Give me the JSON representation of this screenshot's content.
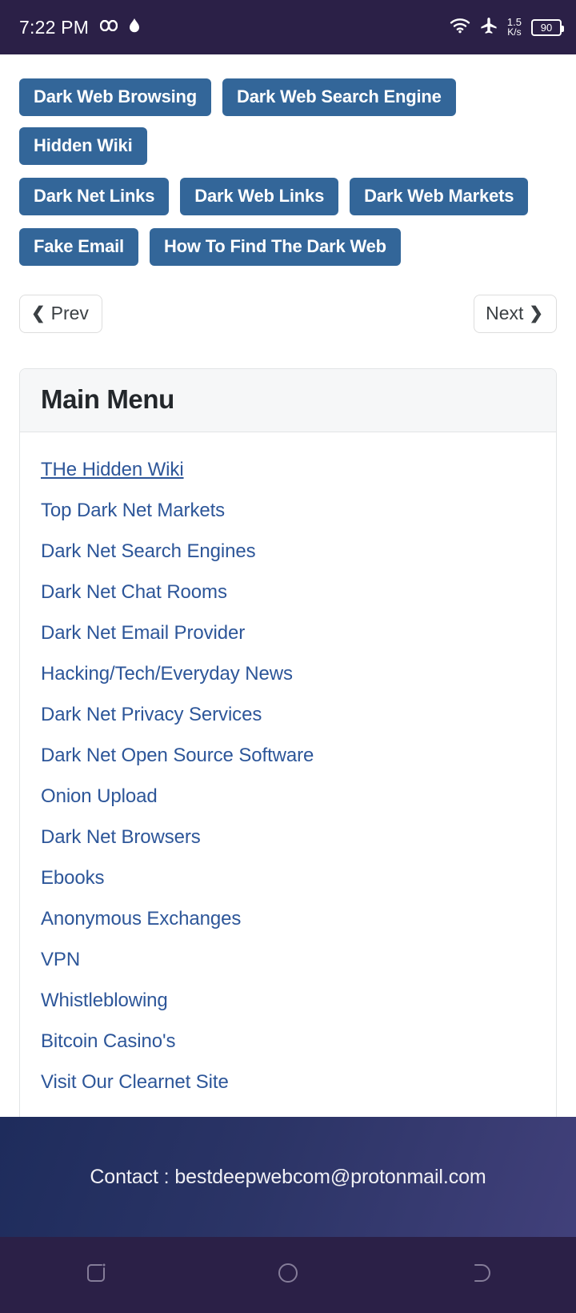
{
  "status_bar": {
    "time": "7:22 PM",
    "left_icons": [
      "glasses-icon",
      "droplet-icon"
    ],
    "wifi_icon": "wifi-icon",
    "airplane_icon": "airplane-mode-icon",
    "net_speed_value": "1.5",
    "net_speed_unit": "K/s",
    "battery_level": "90",
    "background_color": "#2b2047"
  },
  "nav_buttons": {
    "accent_color": "#336699",
    "rows": [
      [
        "Dark Web Browsing",
        "Dark Web Search Engine",
        "Hidden Wiki"
      ],
      [
        "Dark Net Links",
        "Dark Web Links",
        "Dark Web Markets"
      ],
      [
        "Fake Email",
        "How To Find The Dark Web"
      ]
    ]
  },
  "pager": {
    "prev_label": "Prev",
    "next_label": "Next",
    "prev_icon": "chevron-left-icon",
    "next_icon": "chevron-right-icon"
  },
  "main_menu": {
    "title": "Main Menu",
    "links": [
      {
        "label": "THe Hidden Wiki",
        "underlined": true
      },
      {
        "label": "Top Dark Net Markets",
        "underlined": false
      },
      {
        "label": "Dark Net Search Engines",
        "underlined": false
      },
      {
        "label": "Dark Net Chat Rooms",
        "underlined": false
      },
      {
        "label": "Dark Net Email Provider",
        "underlined": false
      },
      {
        "label": "Hacking/Tech/Everyday News",
        "underlined": false
      },
      {
        "label": "Dark Net Privacy Services",
        "underlined": false
      },
      {
        "label": "Dark Net Open Source Software",
        "underlined": false
      },
      {
        "label": "Onion Upload",
        "underlined": false
      },
      {
        "label": "Dark Net Browsers",
        "underlined": false
      },
      {
        "label": "Ebooks",
        "underlined": false
      },
      {
        "label": "Anonymous Exchanges",
        "underlined": false
      },
      {
        "label": "VPN",
        "underlined": false
      },
      {
        "label": "Whistleblowing",
        "underlined": false
      },
      {
        "label": "Bitcoin Casino's",
        "underlined": false
      },
      {
        "label": "Visit Our Clearnet Site",
        "underlined": false
      }
    ],
    "link_color": "#2d5699"
  },
  "footer": {
    "contact_text": "Contact : bestdeepwebcom@protonmail.com"
  },
  "system_nav": {
    "recent_icon": "recent-apps-icon",
    "home_icon": "home-icon",
    "back_icon": "back-icon"
  }
}
